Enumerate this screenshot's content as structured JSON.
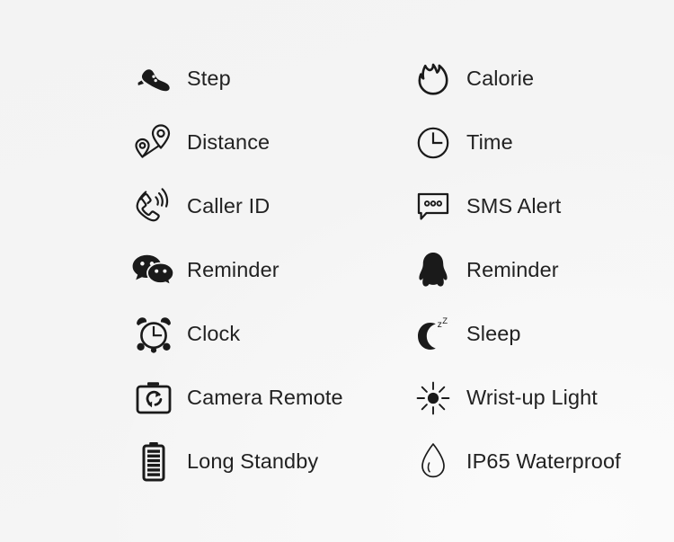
{
  "page": {
    "title": "Smart Watch Feature Icon Grid",
    "background_color": "#f4f4f4",
    "icon_color": "#1a1a1a",
    "text_color": "#222222",
    "columns": 2,
    "rows": 7
  },
  "features": [
    {
      "label": "Step",
      "icon": "shoe-icon",
      "column": "left",
      "row": 1,
      "style": "filled"
    },
    {
      "label": "Calorie",
      "icon": "flame-icon",
      "column": "right",
      "row": 1,
      "style": "outline"
    },
    {
      "label": "Distance",
      "icon": "map-pins-distance-icon",
      "column": "left",
      "row": 2,
      "style": "outline"
    },
    {
      "label": "Time",
      "icon": "clock-icon",
      "column": "right",
      "row": 2,
      "style": "outline"
    },
    {
      "label": "Caller ID",
      "icon": "phone-ringing-icon",
      "column": "left",
      "row": 3,
      "style": "outline"
    },
    {
      "label": "SMS Alert",
      "icon": "sms-bubble-icon",
      "column": "right",
      "row": 3,
      "style": "outline"
    },
    {
      "label": "Reminder",
      "icon": "wechat-icon",
      "column": "left",
      "row": 4,
      "style": "filled"
    },
    {
      "label": "Reminder",
      "icon": "qq-penguin-icon",
      "column": "right",
      "row": 4,
      "style": "filled"
    },
    {
      "label": "Clock",
      "icon": "alarm-clock-icon",
      "column": "left",
      "row": 5,
      "style": "mixed"
    },
    {
      "label": "Sleep",
      "icon": "moon-sleep-icon",
      "column": "right",
      "row": 5,
      "style": "filled"
    },
    {
      "label": "Camera Remote",
      "icon": "camera-remote-icon",
      "column": "left",
      "row": 6,
      "style": "outline"
    },
    {
      "label": "Wrist-up Light",
      "icon": "sun-brightness-icon",
      "column": "right",
      "row": 6,
      "style": "filled"
    },
    {
      "label": "Long Standby",
      "icon": "battery-icon",
      "column": "left",
      "row": 7,
      "style": "filled"
    },
    {
      "label": "IP65 Waterproof",
      "icon": "water-drop-icon",
      "column": "right",
      "row": 7,
      "style": "outline"
    }
  ]
}
